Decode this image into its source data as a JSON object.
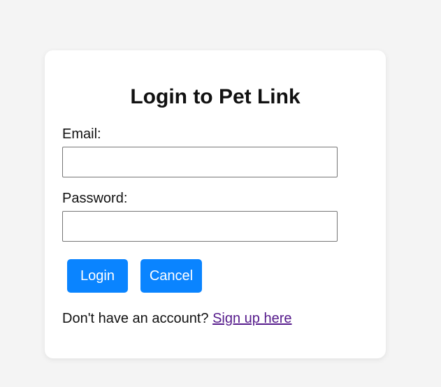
{
  "form": {
    "title": "Login to Pet Link",
    "email_label": "Email:",
    "email_value": "",
    "password_label": "Password:",
    "password_value": "",
    "login_label": "Login",
    "cancel_label": "Cancel",
    "signup_prompt": "Don't have an account?",
    "signup_link": "Sign up here"
  },
  "colors": {
    "background": "#f4f4f4",
    "card": "#ffffff",
    "button": "#0a84ff",
    "button_text": "#ffffff",
    "link_visited": "#551a8b"
  }
}
